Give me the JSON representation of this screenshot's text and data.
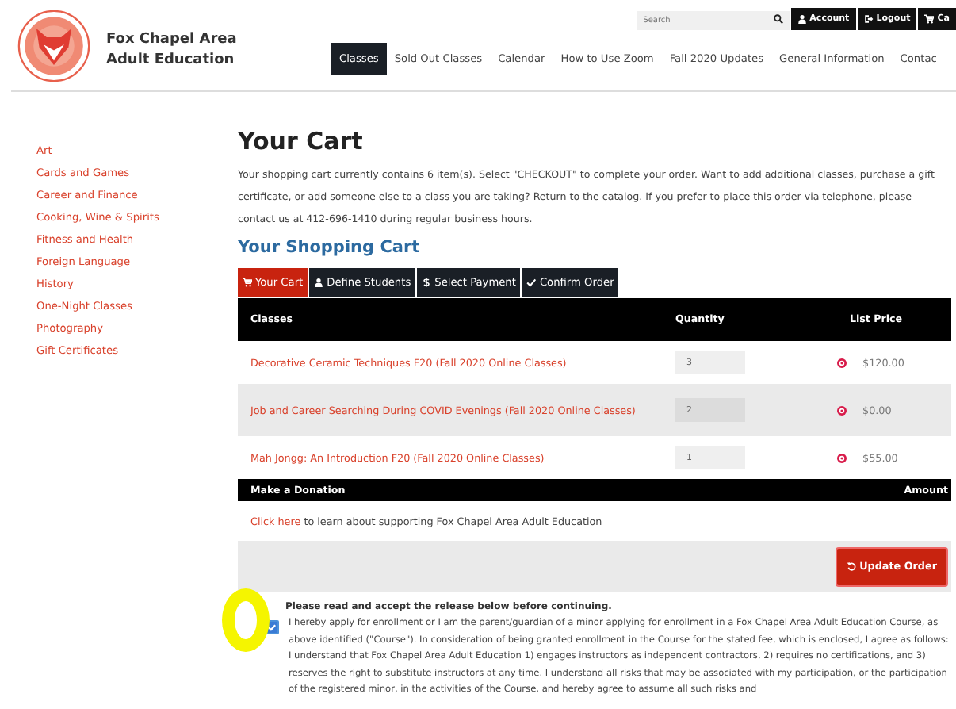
{
  "header": {
    "site_name": [
      "Fox Chapel Area",
      "Adult Education"
    ],
    "search": {
      "placeholder": "Search"
    },
    "account_buttons": [
      {
        "label": "Account",
        "kind": "user"
      },
      {
        "label": "Logout",
        "kind": "logout"
      },
      {
        "label": "Ca",
        "kind": "cart"
      }
    ],
    "nav": [
      {
        "label": "Classes",
        "selected": true
      },
      {
        "label": "Sold Out Classes",
        "selected": false
      },
      {
        "label": "Calendar",
        "selected": false
      },
      {
        "label": "How to Use Zoom",
        "selected": false
      },
      {
        "label": "Fall 2020 Updates",
        "selected": false
      },
      {
        "label": "General Information",
        "selected": false
      },
      {
        "label": "Contac",
        "selected": false
      }
    ]
  },
  "sidebar": {
    "items": [
      "Art",
      "Cards and Games",
      "Career and Finance",
      "Cooking, Wine & Spirits",
      "Fitness and Health",
      "Foreign Language",
      "History",
      "One-Night Classes",
      "Photography",
      "Gift Certificates"
    ]
  },
  "title": "Your Cart",
  "intro": "Your shopping cart currently contains 6 item(s). Select \"CHECKOUT\" to complete your order. Want to add additional classes, purchase a gift certificate, or add someone else to a class you are taking? Return to the catalog. If you prefer to place this order via telephone, please contact us at 412-696-1410 during regular business hours.",
  "subtitle": "Your Shopping Cart",
  "steps": [
    {
      "label": "Your Cart",
      "kind": "cart",
      "selected": true
    },
    {
      "label": "Define Students",
      "kind": "user",
      "selected": false
    },
    {
      "label": "Select Payment",
      "kind": "dollar",
      "selected": false
    },
    {
      "label": "Confirm Order",
      "kind": "check",
      "selected": false
    }
  ],
  "table": {
    "columns": [
      "Classes",
      "Quantity",
      "List Price"
    ],
    "rows": [
      {
        "name": "Decorative Ceramic Techniques F20 (Fall 2020 Online Classes)",
        "quantity": "3",
        "price": "$120.00"
      },
      {
        "name": "Job and Career Searching During COVID Evenings (Fall 2020 Online Classes)",
        "quantity": "2",
        "price": "$0.00"
      },
      {
        "name": "Mah Jongg: An Introduction F20 (Fall 2020 Online Classes)",
        "quantity": "1",
        "price": "$55.00"
      }
    ]
  },
  "donation": {
    "columns": [
      "Make a Donation",
      "Amount"
    ],
    "link": "Click here",
    "text": " to learn about supporting Fox Chapel Area Adult Education"
  },
  "update_button": "Update Order",
  "release": {
    "heading": "Please read and accept the release below before continuing.",
    "checked": true,
    "text": "I hereby apply for enrollment or I am the parent/guardian of a minor applying for enrollment in a Fox Chapel Area Adult Education Course, as above identified (\"Course\"). In consideration of being granted enrollment in the Course for the stated fee, which is enclosed, I agree as follows: I understand that Fox Chapel Area Adult Education 1) engages instructors as independent contractors, 2) requires no certifications, and 3) reserves the right to substitute instructors at any time. I understand all risks that may be associated with my participation, or the participation of the registered minor, in the activities of the Course, and hereby agree to assume all such risks and"
  },
  "annotation": {
    "kind": "circle"
  }
}
